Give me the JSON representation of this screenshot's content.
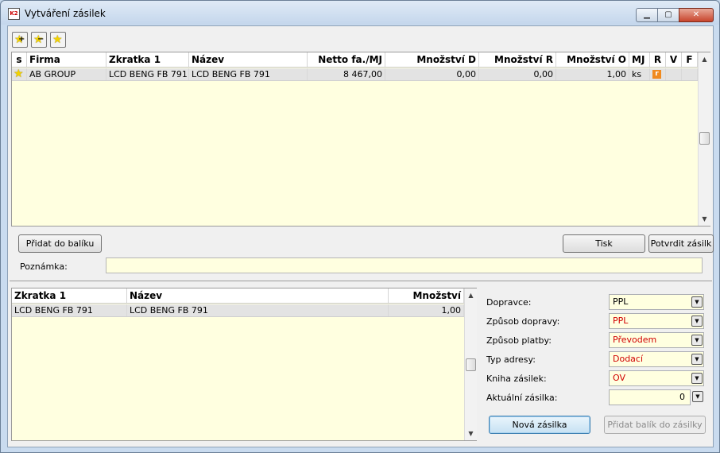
{
  "window": {
    "title": "Vytváření zásilek",
    "icon_text": "K2",
    "min_icon": "minimize-icon",
    "max_icon": "maximize-icon",
    "close_icon": "close-icon",
    "min_glyph": "▁",
    "max_glyph": "▢",
    "close_glyph": "✕"
  },
  "toolbar": {
    "buttons": [
      {
        "icon": "star-add-icon",
        "mark": "+"
      },
      {
        "icon": "star-remove-icon",
        "mark": "−"
      },
      {
        "icon": "star-icon",
        "mark": ""
      }
    ]
  },
  "items_grid": {
    "columns": [
      "s",
      "Firma",
      "Zkratka 1",
      "Název",
      "Netto fa./MJ",
      "Množství D",
      "Množství R",
      "Množství O",
      "MJ",
      "R",
      "V",
      "F"
    ],
    "rows": [
      {
        "firma": "AB GROUP",
        "zkratka": "LCD BENG FB 791",
        "nazev": "LCD BENG FB 791",
        "netto": "8 467,00",
        "mnozstvi_d": "0,00",
        "mnozstvi_r": "0,00",
        "mnozstvi_o": "1,00",
        "mj": "ks",
        "r_badge": "r"
      }
    ]
  },
  "actions": {
    "add_to_package": "Přidat do balíku",
    "print": "Tisk",
    "confirm": "Potvrdit zásilk"
  },
  "note": {
    "label": "Poznámka:",
    "value": ""
  },
  "package_grid": {
    "columns": [
      "Zkratka 1",
      "Název",
      "Množství"
    ],
    "rows": [
      {
        "zkratka": "LCD BENG FB 791",
        "nazev": "LCD BENG FB 791",
        "mnozstvi": "1,00"
      }
    ]
  },
  "form": {
    "dopravce": {
      "label": "Dopravce:",
      "value": "PPL"
    },
    "zpusob_dopravy": {
      "label": "Způsob dopravy:",
      "value": "PPL"
    },
    "zpusob_platby": {
      "label": "Způsob platby:",
      "value": "Převodem"
    },
    "typ_adresy": {
      "label": "Typ adresy:",
      "value": "Dodací"
    },
    "kniha_zasilek": {
      "label": "Kniha zásilek:",
      "value": "OV"
    },
    "aktualni_zasilka": {
      "label": "Aktuální zásilka:",
      "value": "0"
    }
  },
  "bottom_buttons": {
    "new_shipment": "Nová zásilka",
    "add_package_to_shipment": "Přidat balík do zásilky"
  },
  "colors": {
    "grid_bg": "#ffffe0",
    "red_value": "#d10000",
    "badge_orange": "#f08a1f"
  }
}
